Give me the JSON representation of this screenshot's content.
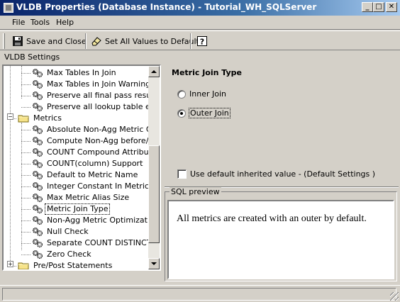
{
  "window": {
    "title": "VLDB Properties (Database Instance) - Tutorial_WH_SQLServer",
    "minimize_glyph": "_",
    "maximize_glyph": "□",
    "close_glyph": "✕"
  },
  "menu": {
    "file": "File",
    "tools": "Tools",
    "help": "Help"
  },
  "toolbar": {
    "save_close_label": "Save and Close",
    "set_default_label": "Set All Values to Default"
  },
  "settings_label": "VLDB Settings",
  "tree": {
    "items_above": [
      "Max Tables In Join",
      "Max Tables in Join Warning",
      "Preserve all final pass result el",
      "Preserve all lookup table eleme"
    ],
    "metrics_folder": "Metrics",
    "metrics_items": [
      "Absolute Non-Agg Metric Quer",
      "Compute Non-Agg before/afte",
      "COUNT Compound Attribute",
      "COUNT(column) Support",
      "Default to Metric Name",
      "Integer Constant In Metric",
      "Max Metric Alias Size",
      "Metric Join Type",
      "Non-Agg Metric Optimization",
      "Null Check",
      "Separate COUNT DISTINCT",
      "Zero Check"
    ],
    "selected": "Metric Join Type",
    "prepost_folder": "Pre/Post Statements"
  },
  "property": {
    "title": "Metric Join Type",
    "inner_join": "Inner Join",
    "outer_join": "Outer Join",
    "selected_option": "Outer Join",
    "use_default_label": "Use default inherited value - (Default Settings )",
    "use_default_checked": false
  },
  "sql_preview": {
    "legend": "SQL preview",
    "text": "All metrics are created with an outer by default."
  },
  "colors": {
    "titlebar_start": "#0a246a",
    "titlebar_end": "#a6caf0",
    "face": "#d4d0c8"
  }
}
